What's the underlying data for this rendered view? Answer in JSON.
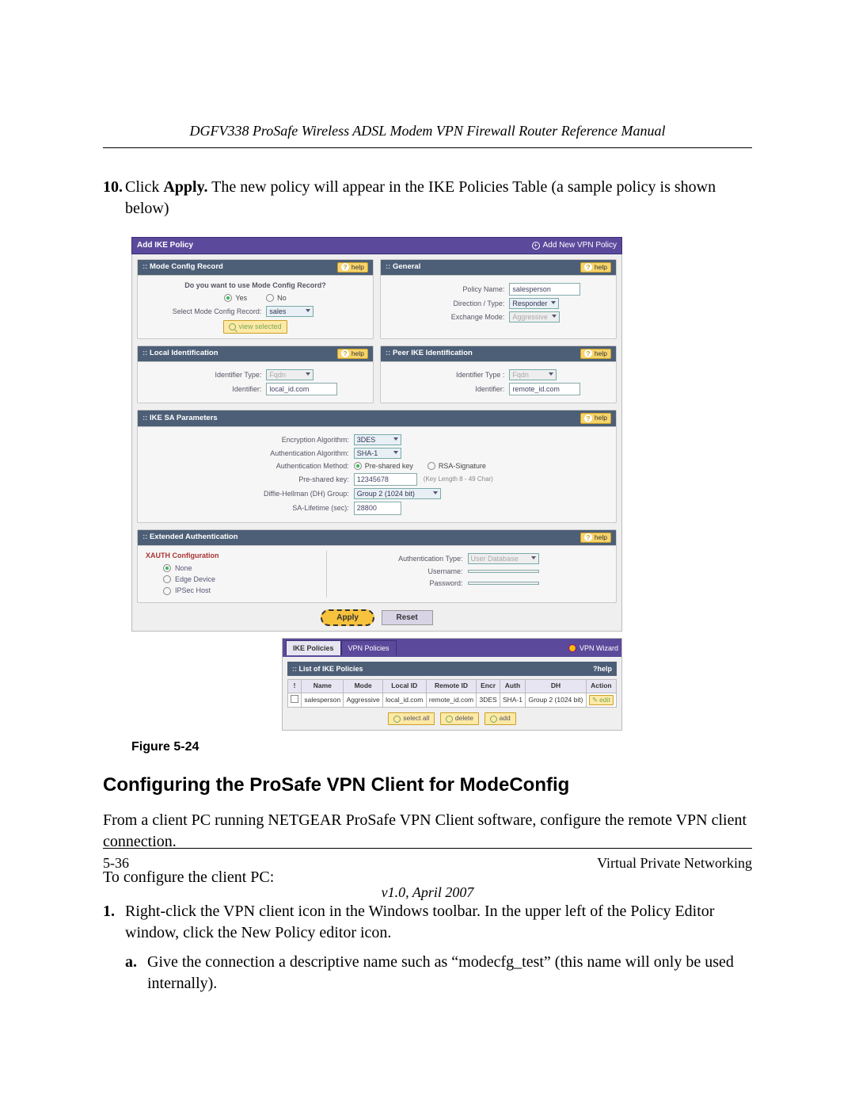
{
  "header_title": "DGFV338 ProSafe Wireless ADSL Modem VPN Firewall Router Reference Manual",
  "step10_num": "10.",
  "step10_a": "Click ",
  "step10_b": "Apply.",
  "step10_c": " The new policy will appear in the IKE Policies Table (a sample policy is shown below)",
  "fig_caption": "Figure 5-24",
  "section_heading": "Configuring the ProSafe VPN Client for ModeConfig",
  "para1": "From a client PC running NETGEAR ProSafe VPN Client software, configure the remote VPN client connection.",
  "para2": "To configure the client PC:",
  "s1_num": "1.",
  "s1_txt": "Right-click the VPN client icon in the Windows toolbar. In the upper left of the Policy Editor window, click the New Policy editor icon.",
  "s1a_num": "a.",
  "s1a_txt": "Give the connection a descriptive name such as “modecfg_test” (this name will only be used internally).",
  "footer_left": "5-36",
  "footer_right": "Virtual Private Networking",
  "footer_ver": "v1.0, April 2007",
  "ui": {
    "top_title": "Add IKE Policy",
    "top_right": "Add New VPN Policy",
    "help": "help",
    "p_mode_title": "Mode Config Record",
    "mode_q": "Do you want to use Mode Config Record?",
    "yes": "Yes",
    "no": "No",
    "sel_mode_lab": "Select Mode Config Record:",
    "sel_mode_val": "sales",
    "view_selected": "view selected",
    "p_general_title": "General",
    "g_policy_lab": "Policy Name:",
    "g_policy_val": "salesperson",
    "g_dir_lab": "Direction / Type:",
    "g_dir_val": "Responder",
    "g_ex_lab": "Exchange Mode:",
    "g_ex_val": "Aggressive",
    "p_local_title": "Local Identification",
    "l_type_lab": "Identifier Type:",
    "l_type_val": "Fqdn",
    "l_id_lab": "Identifier:",
    "l_id_val": "local_id.com",
    "p_peer_title": "Peer IKE Identification",
    "r_type_lab": "Identifier Type :",
    "r_type_val": "Fqdn",
    "r_id_lab": "Identifier:",
    "r_id_val": "remote_id.com",
    "p_sa_title": "IKE SA Parameters",
    "sa_enc_lab": "Encryption Algorithm:",
    "sa_enc_val": "3DES",
    "sa_auth_lab": "Authentication Algorithm:",
    "sa_auth_val": "SHA-1",
    "sa_meth_lab": "Authentication Method:",
    "sa_meth_a": "Pre-shared key",
    "sa_meth_b": "RSA-Signature",
    "sa_psk_lab": "Pre-shared key:",
    "sa_psk_val": "12345678",
    "sa_psk_note": "(Key Length 8 - 49 Char)",
    "sa_dh_lab": "Diffie-Hellman (DH) Group:",
    "sa_dh_val": "Group 2 (1024 bit)",
    "sa_life_lab": "SA-Lifetime (sec):",
    "sa_life_val": "28800",
    "p_x_title": "Extended Authentication",
    "x_conf": "XAUTH Configuration",
    "x_none": "None",
    "x_edge": "Edge Device",
    "x_ipsec": "IPSec Host",
    "x_at_lab": "Authentication Type:",
    "x_at_val": "User Database",
    "x_un_lab": "Username:",
    "x_pw_lab": "Password:",
    "btn_apply": "Apply",
    "btn_reset": "Reset",
    "tab_ike": "IKE Policies",
    "tab_vpn": "VPN Policies",
    "wiz": "VPN Wizard",
    "list_title": "List of IKE Policies",
    "th_name": "Name",
    "th_mode": "Mode",
    "th_lid": "Local ID",
    "th_rid": "Remote ID",
    "th_encr": "Encr",
    "th_auth": "Auth",
    "th_dh": "DH",
    "th_act": "Action",
    "td_name": "salesperson",
    "td_mode": "Aggressive",
    "td_lid": "local_id.com",
    "td_rid": "remote_id.com",
    "td_encr": "3DES",
    "td_auth": "SHA-1",
    "td_dh": "Group 2 (1024 bit)",
    "td_act": "edit",
    "ab_selall": "select all",
    "ab_del": "delete",
    "ab_add": "add"
  }
}
